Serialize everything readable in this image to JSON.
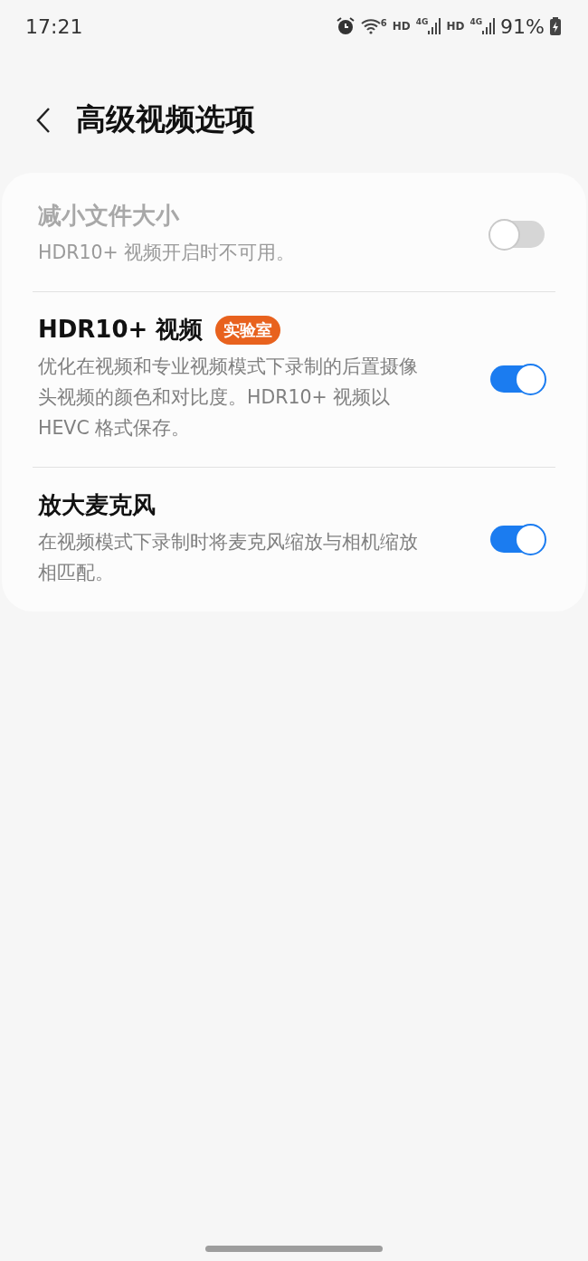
{
  "status_bar": {
    "time": "17:21",
    "indicators": [
      {
        "kind": "alarm"
      },
      {
        "kind": "wifi",
        "label": "6"
      },
      {
        "kind": "hd",
        "label": "HD"
      },
      {
        "kind": "signal",
        "label": "4G"
      },
      {
        "kind": "hd",
        "label": "HD"
      },
      {
        "kind": "signal",
        "label": "4G"
      }
    ],
    "battery": "91%",
    "charging": true
  },
  "header": {
    "title": "高级视频选项"
  },
  "items": [
    {
      "title": "减小文件大小",
      "description": "HDR10+ 视频开启时不可用。",
      "disabled": true,
      "on": false
    },
    {
      "title": "HDR10+ 视频",
      "badge": "实验室",
      "description": "优化在视频和专业视频模式下录制的后置摄像头视频的颜色和对比度。HDR10+ 视频以 HEVC 格式保存。",
      "disabled": false,
      "on": true
    },
    {
      "title": "放大麦克风",
      "description": "在视频模式下录制时将麦克风缩放与相机缩放相匹配。",
      "disabled": false,
      "on": true
    }
  ]
}
